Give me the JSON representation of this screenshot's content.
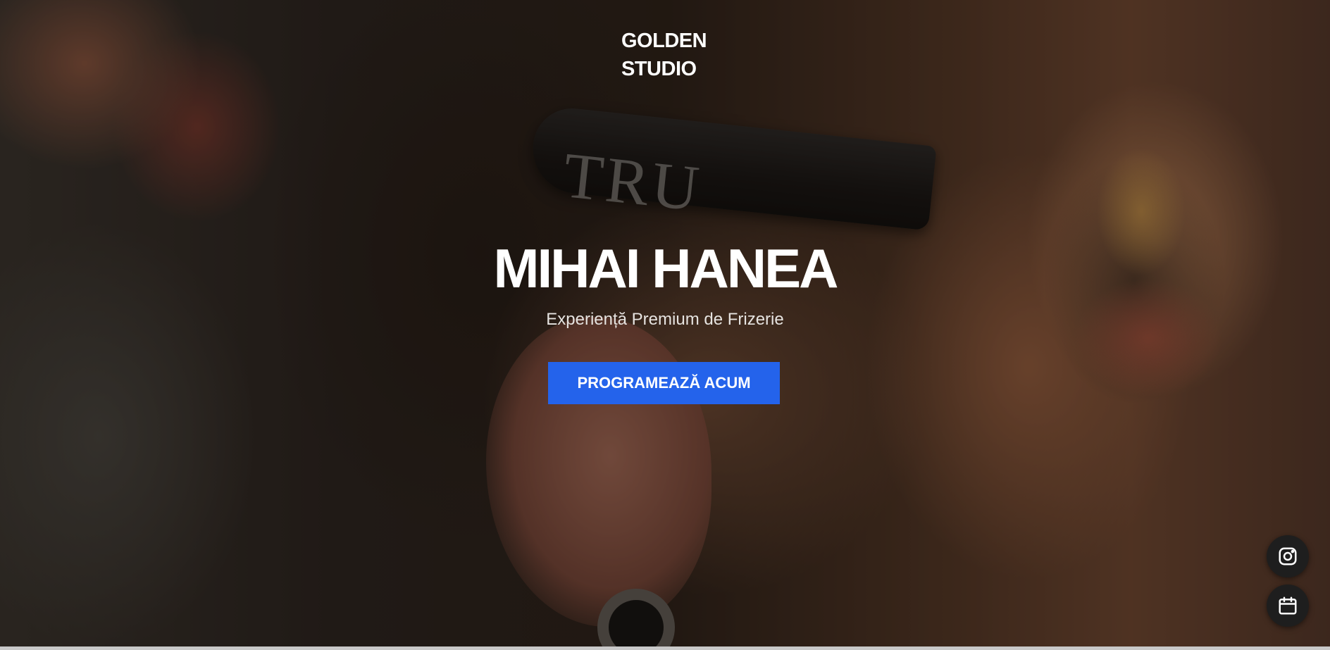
{
  "brand": {
    "line1": "GOLDEN",
    "line2": "STUDIO"
  },
  "hero": {
    "title": "MIHAI HANEA",
    "subtitle": "Experiență Premium de Frizerie",
    "cta_label": "PROGRAMEAZĂ ACUM",
    "background_text": "TRU"
  },
  "floating_actions": [
    {
      "icon": "instagram-icon"
    },
    {
      "icon": "calendar-icon"
    }
  ],
  "colors": {
    "accent": "#2463eb",
    "text": "#ffffff",
    "fab_background": "#1e1e1e"
  }
}
